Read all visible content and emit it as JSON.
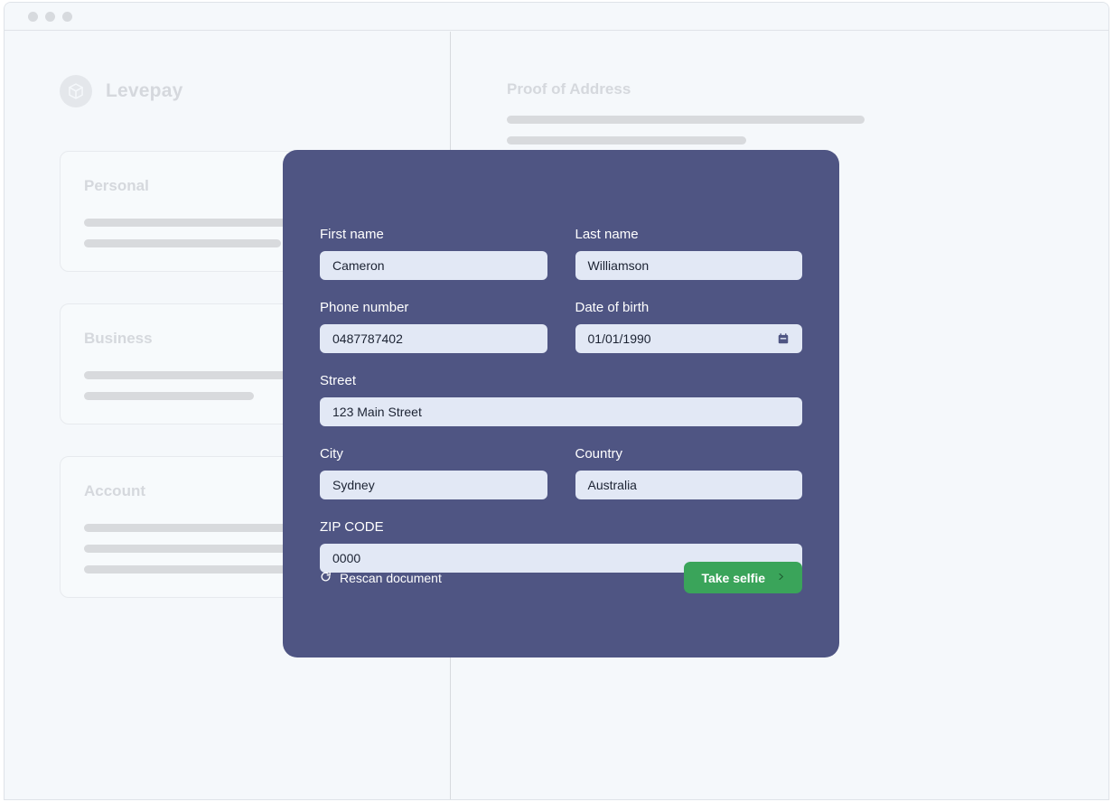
{
  "window": {
    "traffic_lights": [
      "dot-1",
      "dot-2",
      "dot-3"
    ]
  },
  "brand": {
    "name": "Levepay",
    "icon": "cube-icon"
  },
  "left_panel": {
    "cards": [
      {
        "title": "Personal",
        "bars": [
          100,
          58
        ]
      },
      {
        "title": "Business",
        "bars": [
          100,
          50
        ]
      },
      {
        "title": "Account",
        "bars": [
          100,
          100,
          75
        ]
      }
    ]
  },
  "right_panel": {
    "title": "Proof of Address",
    "bars": [
      100,
      67
    ]
  },
  "modal": {
    "fields": [
      {
        "label": "First name",
        "value": "Cameron",
        "name": "first-name"
      },
      {
        "label": "Last name",
        "value": "Williamson",
        "name": "last-name"
      },
      {
        "label": "Phone number",
        "value": "0487787402",
        "name": "phone-number"
      },
      {
        "label": "Date of birth",
        "value": "01/01/1990",
        "name": "date-of-birth",
        "icon": "calendar-icon"
      },
      {
        "label": "Street",
        "value": "123 Main Street",
        "name": "street"
      },
      {
        "label": "City",
        "value": "Sydney",
        "name": "city"
      },
      {
        "label": "Country",
        "value": "Australia",
        "name": "country"
      },
      {
        "label": "ZIP CODE",
        "value": "0000",
        "name": "zip-code"
      }
    ],
    "rescan_label": "Rescan document",
    "rescan_icon": "refresh-icon",
    "submit_label": "Take selfie",
    "submit_icon": "chevron-right-icon"
  },
  "colors": {
    "modal_bg": "#4f5583",
    "input_bg": "#e2e8f5",
    "accent_green": "#3aa45a",
    "page_bg": "#f5f8fb",
    "skeleton": "#d8dadd"
  }
}
